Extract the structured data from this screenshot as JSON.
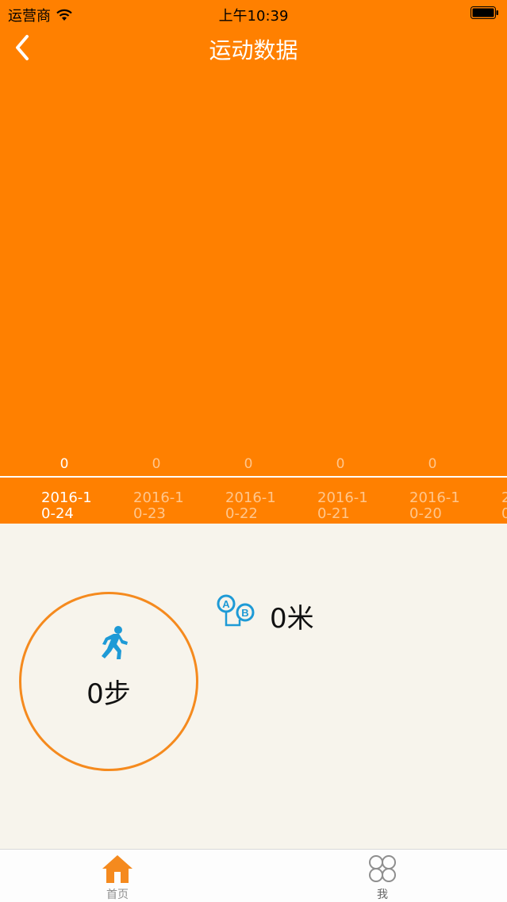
{
  "status_bar": {
    "carrier": "运营商",
    "time": "上午10:39"
  },
  "nav": {
    "title": "运动数据"
  },
  "chart_data": {
    "type": "bar",
    "categories": [
      "2016-10-24",
      "2016-10-23",
      "2016-10-22",
      "2016-10-21",
      "2016-10-20"
    ],
    "category_labels": [
      "2016-1\n0-24",
      "2016-1\n0-23",
      "2016-1\n0-22",
      "2016-1\n0-21",
      "2016-1\n0-20",
      "2\n0"
    ],
    "values": [
      0,
      0,
      0,
      0,
      0
    ],
    "value_labels": [
      "0",
      "0",
      "0",
      "0",
      "0"
    ],
    "selected_index": 0
  },
  "summary": {
    "steps": "0步",
    "distance": "0米"
  },
  "tab_bar": {
    "items": [
      {
        "label": "首页",
        "icon": "home-icon",
        "active": true
      },
      {
        "label": "我",
        "icon": "clover-icon",
        "active": false
      }
    ]
  },
  "colors": {
    "primary": "#ff8000",
    "background": "#f7f4ec",
    "accent_blue": "#1e9ad6",
    "inactive": "#8e8e8e"
  }
}
